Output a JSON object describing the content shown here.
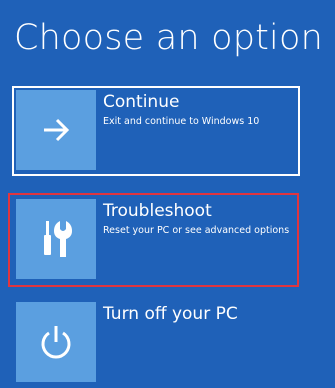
{
  "title": "Choose an option",
  "options": [
    {
      "label": "Continue",
      "description": "Exit and continue to Windows 10",
      "icon": "arrow-right-icon"
    },
    {
      "label": "Troubleshoot",
      "description": "Reset your PC or see advanced options",
      "icon": "screwdriver-wrench-icon"
    },
    {
      "label": "Turn off your PC",
      "description": "",
      "icon": "power-icon"
    }
  ],
  "colors": {
    "background": "#1f61b8",
    "tile": "#5b9fe0",
    "focus_border": "#ffffff",
    "highlight": "#e0353f"
  }
}
